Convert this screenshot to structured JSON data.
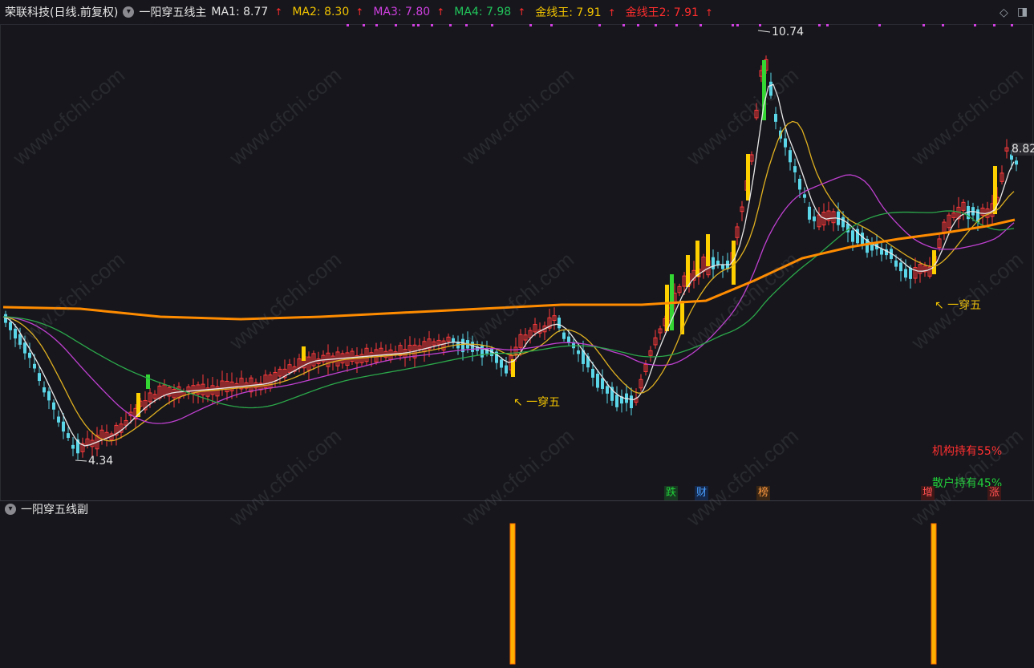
{
  "header": {
    "stock_name": "荣联科技(日线.前复权)",
    "indicator_main": "一阳穿五线主",
    "ma1_label": "MA1: 8.77",
    "ma2_label": "MA2: 8.30",
    "ma3_label": "MA3: 7.80",
    "ma4_label": "MA4: 7.98",
    "jxw_label": "金线王: 7.91",
    "jxw2_label": "金线王2: 7.91",
    "arrow": "↑"
  },
  "annotations": {
    "high": "10.74",
    "low": "4.34",
    "last": "8.82",
    "cross1": "↖ 一穿五",
    "cross2": "↖ 一穿五",
    "inst": "机构持有55%",
    "retail": "散户持有45%"
  },
  "tags": {
    "die": "跌",
    "cai": "财",
    "bang": "榜",
    "zeng": "增",
    "zhang": "涨"
  },
  "sub_panel": {
    "title": "一阳穿五线副"
  },
  "icons": {
    "collapse": "chevron-down-icon",
    "diamond": "diamond-icon",
    "window": "window-icon"
  },
  "colors": {
    "ma1": "#e8e8e8",
    "ma2": "#e0b020",
    "ma3": "#c040d0",
    "ma4": "#2ca84a",
    "gold": "#ff8c00",
    "up": "#ff3b3b",
    "down": "#5ad6e8",
    "signal": "#ffd000"
  },
  "watermark_text": "www.cfchi.com"
}
